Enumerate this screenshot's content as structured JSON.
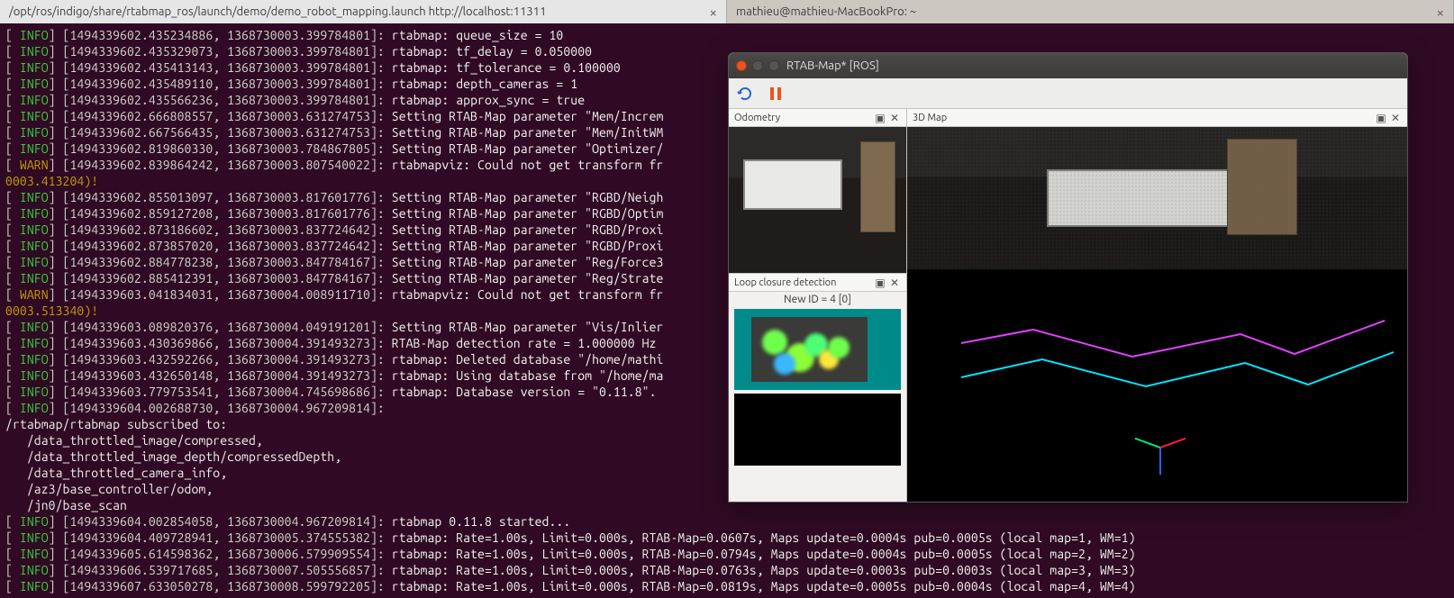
{
  "tabs": {
    "tab1": "/opt/ros/indigo/share/rtabmap_ros/launch/demo/demo_robot_mapping.launch http://localhost:11311",
    "tab2": "mathieu@mathieu-MacBookPro: ~"
  },
  "logs": [
    {
      "lvl": "INFO",
      "ts": "[1494339602.435234886, 1368730003.399784801]",
      "msg": "rtabmap: queue_size = 10"
    },
    {
      "lvl": "INFO",
      "ts": "[1494339602.435329073, 1368730003.399784801]",
      "msg": "rtabmap: tf_delay = 0.050000"
    },
    {
      "lvl": "INFO",
      "ts": "[1494339602.435413143, 1368730003.399784801]",
      "msg": "rtabmap: tf_tolerance = 0.100000"
    },
    {
      "lvl": "INFO",
      "ts": "[1494339602.435489110, 1368730003.399784801]",
      "msg": "rtabmap: depth_cameras = 1"
    },
    {
      "lvl": "INFO",
      "ts": "[1494339602.435566236, 1368730003.399784801]",
      "msg": "rtabmap: approx_sync = true"
    },
    {
      "lvl": "INFO",
      "ts": "[1494339602.666808557, 1368730003.631274753]",
      "msg": "Setting RTAB-Map parameter \"Mem/Increm"
    },
    {
      "lvl": "INFO",
      "ts": "[1494339602.667566435, 1368730003.631274753]",
      "msg": "Setting RTAB-Map parameter \"Mem/InitWM"
    },
    {
      "lvl": "INFO",
      "ts": "[1494339602.819860330, 1368730003.784867805]",
      "msg": "Setting RTAB-Map parameter \"Optimizer/"
    },
    {
      "lvl": "WARN",
      "ts": "[1494339602.839864242, 1368730003.807540022]",
      "msg": "rtabmapviz: Could not get transform fr",
      "cont": "0003.413204)!"
    },
    {
      "lvl": "INFO",
      "ts": "[1494339602.855013097, 1368730003.817601776]",
      "msg": "Setting RTAB-Map parameter \"RGBD/Neigh"
    },
    {
      "lvl": "INFO",
      "ts": "[1494339602.859127208, 1368730003.817601776]",
      "msg": "Setting RTAB-Map parameter \"RGBD/Optim"
    },
    {
      "lvl": "INFO",
      "ts": "[1494339602.873186602, 1368730003.837724642]",
      "msg": "Setting RTAB-Map parameter \"RGBD/Proxi"
    },
    {
      "lvl": "INFO",
      "ts": "[1494339602.873857020, 1368730003.837724642]",
      "msg": "Setting RTAB-Map parameter \"RGBD/Proxi"
    },
    {
      "lvl": "INFO",
      "ts": "[1494339602.884778238, 1368730003.847784167]",
      "msg": "Setting RTAB-Map parameter \"Reg/Force3"
    },
    {
      "lvl": "INFO",
      "ts": "[1494339602.885412391, 1368730003.847784167]",
      "msg": "Setting RTAB-Map parameter \"Reg/Strate"
    },
    {
      "lvl": "WARN",
      "ts": "[1494339603.041834031, 1368730004.008911710]",
      "msg": "rtabmapviz: Could not get transform fr",
      "cont": "0003.513340)!"
    },
    {
      "lvl": "INFO",
      "ts": "[1494339603.089820376, 1368730004.049191201]",
      "msg": "Setting RTAB-Map parameter \"Vis/Inlier"
    },
    {
      "lvl": "INFO",
      "ts": "[1494339603.430369866, 1368730004.391493273]",
      "msg": "RTAB-Map detection rate = 1.000000 Hz"
    },
    {
      "lvl": "INFO",
      "ts": "[1494339603.432592266, 1368730004.391493273]",
      "msg": "rtabmap: Deleted database \"/home/mathi"
    },
    {
      "lvl": "INFO",
      "ts": "[1494339603.432650148, 1368730004.391493273]",
      "msg": "rtabmap: Using database from \"/home/ma"
    },
    {
      "lvl": "INFO",
      "ts": "[1494339603.779753541, 1368730004.745698686]",
      "msg": "rtabmap: Database version = \"0.11.8\"."
    },
    {
      "lvl": "INFO",
      "ts": "[1494339604.002688730, 1368730004.967209814]",
      "msg": ""
    }
  ],
  "subscribed_header": "/rtabmap/rtabmap subscribed to:",
  "subscribed": [
    "/data_throttled_image/compressed,",
    "/data_throttled_image_depth/compressedDepth,",
    "/data_throttled_camera_info,",
    "/az3/base_controller/odom,",
    "/jn0/base_scan"
  ],
  "logs2": [
    {
      "lvl": "INFO",
      "ts": "[1494339604.002854058, 1368730004.967209814]",
      "msg": "rtabmap 0.11.8 started..."
    },
    {
      "lvl": "INFO",
      "ts": "[1494339604.409728941, 1368730005.374555382]",
      "msg": "rtabmap: Rate=1.00s, Limit=0.000s, RTAB-Map=0.0607s, Maps update=0.0004s pub=0.0005s (local map=1, WM=1)"
    },
    {
      "lvl": "INFO",
      "ts": "[1494339605.614598362, 1368730006.579909554]",
      "msg": "rtabmap: Rate=1.00s, Limit=0.000s, RTAB-Map=0.0794s, Maps update=0.0004s pub=0.0005s (local map=2, WM=2)"
    },
    {
      "lvl": "INFO",
      "ts": "[1494339606.539717685, 1368730007.505556857]",
      "msg": "rtabmap: Rate=1.00s, Limit=0.000s, RTAB-Map=0.0763s, Maps update=0.0003s pub=0.0003s (local map=3, WM=3)"
    },
    {
      "lvl": "INFO",
      "ts": "[1494339607.633050278, 1368730008.599792205]",
      "msg": "rtabmap: Rate=1.00s, Limit=0.000s, RTAB-Map=0.0819s, Maps update=0.0005s pub=0.0004s (local map=4, WM=4)"
    }
  ],
  "rtab": {
    "title": "RTAB-Map* [ROS]",
    "odom_label": "Odometry",
    "map3d_label": "3D Map",
    "loop_label": "Loop closure detection",
    "loop_newid": "New ID = 4 [0]"
  }
}
